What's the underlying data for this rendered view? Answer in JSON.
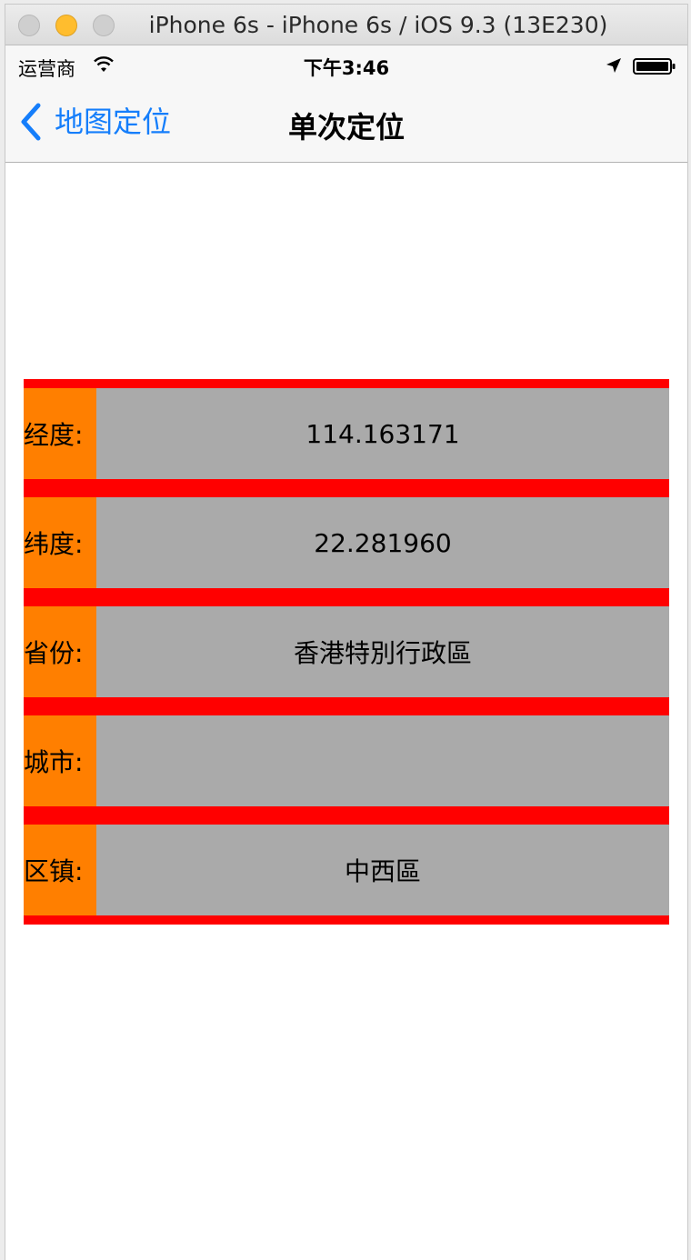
{
  "window": {
    "title": "iPhone 6s - iPhone 6s / iOS 9.3 (13E230)"
  },
  "statusbar": {
    "carrier": "运营商",
    "time": "下午3:46",
    "icons": [
      "wifi-icon",
      "location-arrow-icon",
      "battery-icon"
    ]
  },
  "navbar": {
    "back_label": "地图定位",
    "title": "单次定位",
    "tint_color": "#157efb"
  },
  "info": {
    "rows": [
      {
        "label": "经度:",
        "value": "114.163171"
      },
      {
        "label": "纬度:",
        "value": "22.281960"
      },
      {
        "label": "省份:",
        "value": "香港特別行政區"
      },
      {
        "label": "城市:",
        "value": ""
      },
      {
        "label": "区镇:",
        "value": "中西區"
      }
    ],
    "colors": {
      "border": "#ff0000",
      "label_bg": "#ff7f00",
      "value_bg": "#aaaaaa"
    }
  }
}
